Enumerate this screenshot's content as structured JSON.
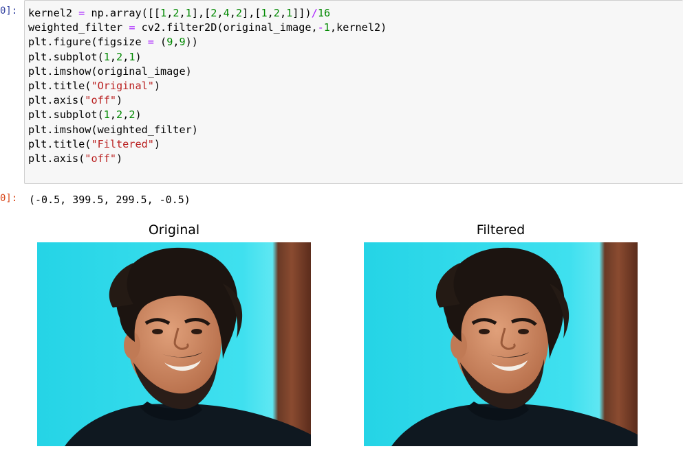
{
  "notebook": {
    "input_prompt": "0]:",
    "output_prompt": "0]:",
    "code_lines": [
      [
        {
          "t": "kernel2 "
        },
        {
          "t": "=",
          "c": "op"
        },
        {
          "t": " np.array([["
        },
        {
          "t": "1",
          "c": "num"
        },
        {
          "t": ","
        },
        {
          "t": "2",
          "c": "num"
        },
        {
          "t": ","
        },
        {
          "t": "1",
          "c": "num"
        },
        {
          "t": "],["
        },
        {
          "t": "2",
          "c": "num"
        },
        {
          "t": ","
        },
        {
          "t": "4",
          "c": "num"
        },
        {
          "t": ","
        },
        {
          "t": "2",
          "c": "num"
        },
        {
          "t": "],["
        },
        {
          "t": "1",
          "c": "num"
        },
        {
          "t": ","
        },
        {
          "t": "2",
          "c": "num"
        },
        {
          "t": ","
        },
        {
          "t": "1",
          "c": "num"
        },
        {
          "t": "]])"
        },
        {
          "t": "/",
          "c": "op"
        },
        {
          "t": "16",
          "c": "num"
        }
      ],
      [
        {
          "t": "weighted_filter "
        },
        {
          "t": "=",
          "c": "op"
        },
        {
          "t": " cv2.filter2D(original_image,"
        },
        {
          "t": "-",
          "c": "op"
        },
        {
          "t": "1",
          "c": "num"
        },
        {
          "t": ",kernel2)"
        }
      ],
      [
        {
          "t": "plt.figure(figsize "
        },
        {
          "t": "=",
          "c": "op"
        },
        {
          "t": " ("
        },
        {
          "t": "9",
          "c": "num"
        },
        {
          "t": ","
        },
        {
          "t": "9",
          "c": "num"
        },
        {
          "t": "))"
        }
      ],
      [
        {
          "t": "plt.subplot("
        },
        {
          "t": "1",
          "c": "num"
        },
        {
          "t": ","
        },
        {
          "t": "2",
          "c": "num"
        },
        {
          "t": ","
        },
        {
          "t": "1",
          "c": "num"
        },
        {
          "t": ")"
        }
      ],
      [
        {
          "t": "plt.imshow(original_image)"
        }
      ],
      [
        {
          "t": "plt.title("
        },
        {
          "t": "\"Original\"",
          "c": "str"
        },
        {
          "t": ")"
        }
      ],
      [
        {
          "t": "plt.axis("
        },
        {
          "t": "\"off\"",
          "c": "str"
        },
        {
          "t": ")"
        }
      ],
      [
        {
          "t": "plt.subplot("
        },
        {
          "t": "1",
          "c": "num"
        },
        {
          "t": ","
        },
        {
          "t": "2",
          "c": "num"
        },
        {
          "t": ","
        },
        {
          "t": "2",
          "c": "num"
        },
        {
          "t": ")"
        }
      ],
      [
        {
          "t": "plt.imshow(weighted_filter)"
        }
      ],
      [
        {
          "t": "plt.title("
        },
        {
          "t": "\"Filtered\"",
          "c": "str"
        },
        {
          "t": ")"
        }
      ],
      [
        {
          "t": "plt.axis("
        },
        {
          "t": "\"off\"",
          "c": "str"
        },
        {
          "t": ")"
        }
      ]
    ],
    "output_text": "(-0.5, 399.5, 299.5, -0.5)",
    "subplots": [
      {
        "title": "Original",
        "image": "portrait-photo-original"
      },
      {
        "title": "Filtered",
        "image": "portrait-photo-filtered"
      }
    ],
    "colors": {
      "input_prompt": "#303f9f",
      "output_prompt": "#d84315",
      "operator": "#aa22ff",
      "number": "#008800",
      "string": "#ba2121",
      "background_cyan": "#2fd6e8"
    }
  }
}
